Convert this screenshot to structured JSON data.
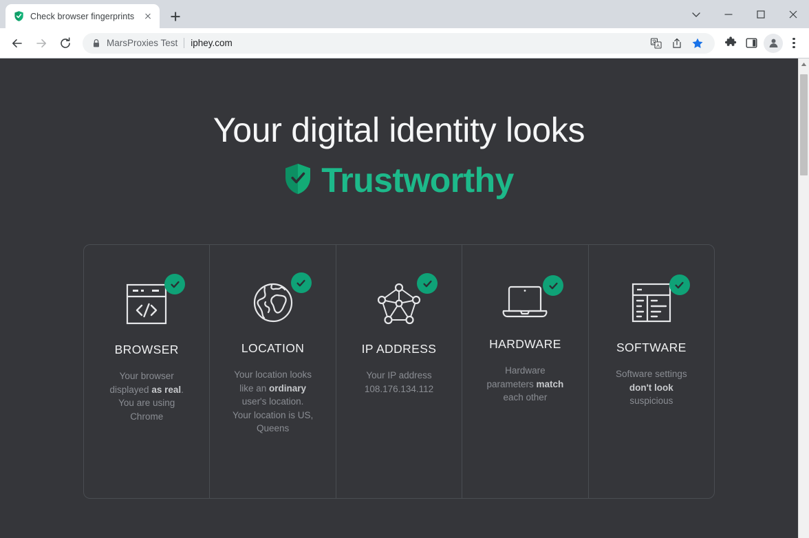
{
  "window": {
    "controls": [
      {
        "name": "tab-search",
        "icon": "chevron-down-icon"
      },
      {
        "name": "minimize",
        "icon": "minimize-icon"
      },
      {
        "name": "maximize",
        "icon": "maximize-icon"
      },
      {
        "name": "close",
        "icon": "close-icon"
      }
    ]
  },
  "tabs": [
    {
      "title": "Check browser fingerprints",
      "favicon": "shield-check-icon",
      "active": true
    }
  ],
  "newtab": {
    "tooltip": "New tab",
    "icon": "plus-icon"
  },
  "toolbar": {
    "back": "back-arrow-icon",
    "forward": "forward-arrow-icon",
    "reload": "reload-icon",
    "omnibox": {
      "lock_icon": "lock-icon",
      "prefix": "MarsProxies Test",
      "url": "iphey.com",
      "translate_icon": "translate-icon",
      "share_icon": "share-icon",
      "bookmark_icon": "star-filled-icon"
    },
    "extensions_icon": "puzzle-piece-icon",
    "side_panel_icon": "side-panel-icon",
    "profile_icon": "person-avatar-icon",
    "menu_icon": "three-dots-vertical-icon"
  },
  "scrollbar": {
    "up_arrow": "caret-up-icon"
  },
  "page": {
    "background": "#35363a",
    "accent": "#1db98a",
    "badge_color": "#0fa277",
    "hero": {
      "line1": "Your digital identity looks",
      "status_label": "Trustworthy",
      "status_icon": "shield-check-icon"
    },
    "cards": [
      {
        "key": "browser",
        "icon": "browser-code-window-icon",
        "badge": "check-circle-icon",
        "title": "BROWSER",
        "desc_parts": [
          {
            "text": "Your browser displayed ",
            "bold": false
          },
          {
            "text": "as real",
            "bold": true
          },
          {
            "text": ". You are using Chrome",
            "bold": false
          }
        ],
        "desc_plain": "Your browser displayed as real. You are using Chrome"
      },
      {
        "key": "location",
        "icon": "globe-icon",
        "badge": "check-circle-icon",
        "title": "LOCATION",
        "desc_parts": [
          {
            "text": "Your location looks like an ",
            "bold": false
          },
          {
            "text": "ordinary",
            "bold": true
          },
          {
            "text": " user's location. Your location is US, Queens",
            "bold": false
          }
        ],
        "desc_plain": "Your location looks like an ordinary user's location. Your location is US, Queens"
      },
      {
        "key": "ip",
        "icon": "network-nodes-icon",
        "badge": "check-circle-icon",
        "title": "IP ADDRESS",
        "desc_parts": [
          {
            "text": "Your IP address 108.176.134.112",
            "bold": false
          }
        ],
        "desc_plain": "Your IP address 108.176.134.112",
        "ip_value": "108.176.134.112"
      },
      {
        "key": "hardware",
        "icon": "laptop-icon",
        "badge": "check-circle-icon",
        "title": "HARDWARE",
        "desc_parts": [
          {
            "text": "Hardware parameters ",
            "bold": false
          },
          {
            "text": "match",
            "bold": true
          },
          {
            "text": " each other",
            "bold": false
          }
        ],
        "desc_plain": "Hardware parameters match each other"
      },
      {
        "key": "software",
        "icon": "software-panels-icon",
        "badge": "check-circle-icon",
        "title": "SOFTWARE",
        "desc_parts": [
          {
            "text": "Software settings ",
            "bold": false
          },
          {
            "text": "don't look",
            "bold": true
          },
          {
            "text": " suspicious",
            "bold": false
          }
        ],
        "desc_plain": "Software settings don't look suspicious"
      }
    ]
  }
}
